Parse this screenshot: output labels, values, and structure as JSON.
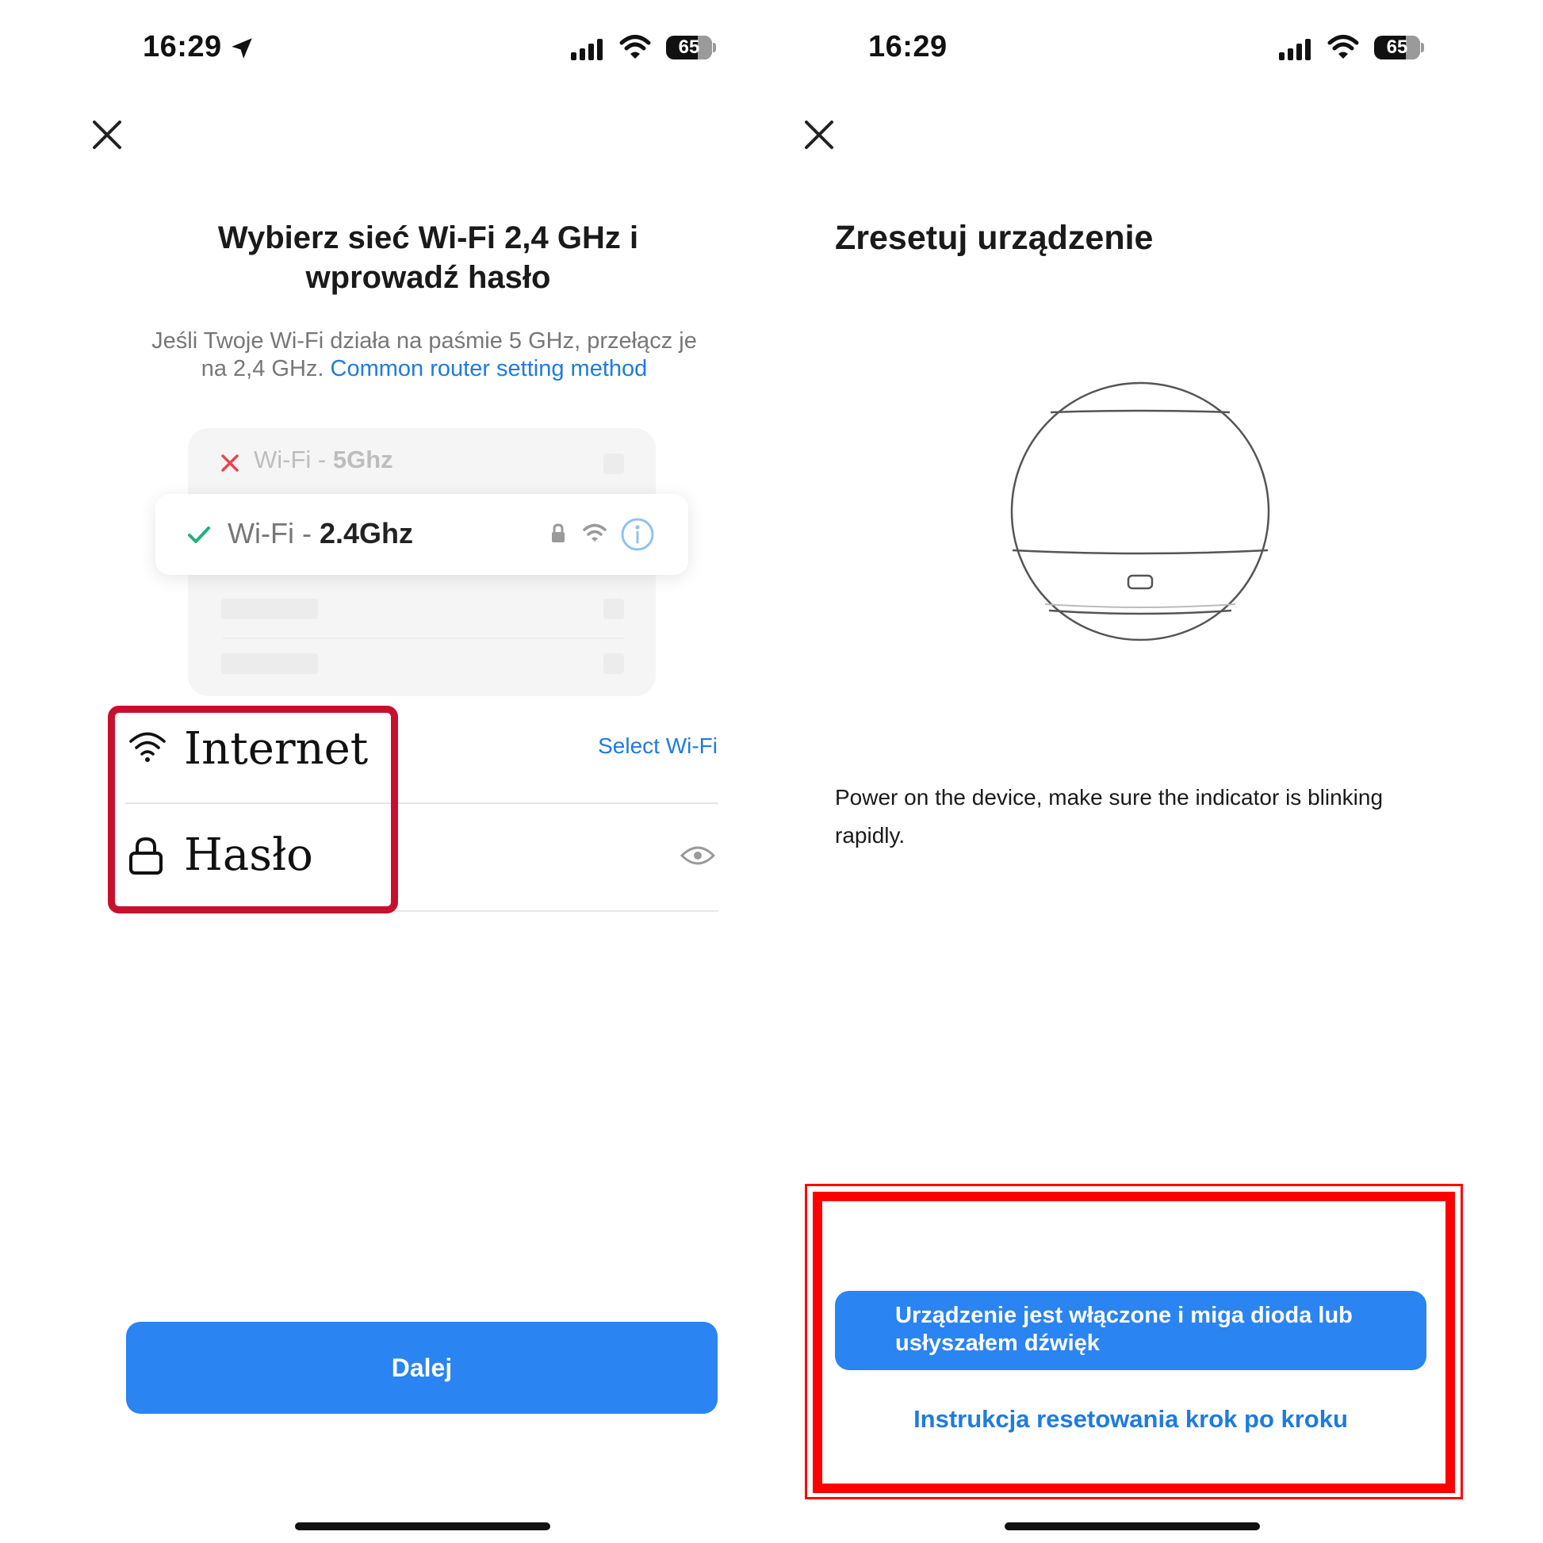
{
  "left": {
    "status": {
      "time": "16:29",
      "battery": "65"
    },
    "title": "Wybierz sieć Wi-Fi 2,4 GHz i wprowadź hasło",
    "title_line1": "Wybierz sieć Wi-Fi 2,4 GHz i",
    "title_line2": "wprowadź hasło",
    "description_line1": "Jeśli Twoje Wi-Fi działa na paśmie 5 GHz, przełącz je",
    "description_line2_prefix": "na 2,4 GHz.",
    "router_link": "Common router setting method",
    "illustration": {
      "row_bad": {
        "prefix": "Wi-Fi -",
        "band": "5Ghz"
      },
      "row_good": {
        "prefix": "Wi-Fi -",
        "band": "2.4Ghz"
      }
    },
    "network_label": "Internet",
    "select_wifi": "Select Wi-Fi",
    "password_label": "Hasło",
    "next_button": "Dalej"
  },
  "right": {
    "status": {
      "time": "16:29",
      "battery": "65"
    },
    "title": "Zresetuj urządzenie",
    "instruction_line1": "Power on the device, make sure the indicator is blinking",
    "instruction_line2": "rapidly.",
    "confirm_button_line1": "Urządzenie jest włączone i miga dioda lub",
    "confirm_button_line2": "usłyszałem dźwięk",
    "reset_link": "Instrukcja resetowania krok po kroku"
  },
  "colors": {
    "accent": "#2a84f2",
    "link": "#1e7be0",
    "highlight_left": "#c8102e",
    "highlight_right": "#ff0000",
    "check": "#22b07d",
    "cross": "#e5484d"
  }
}
